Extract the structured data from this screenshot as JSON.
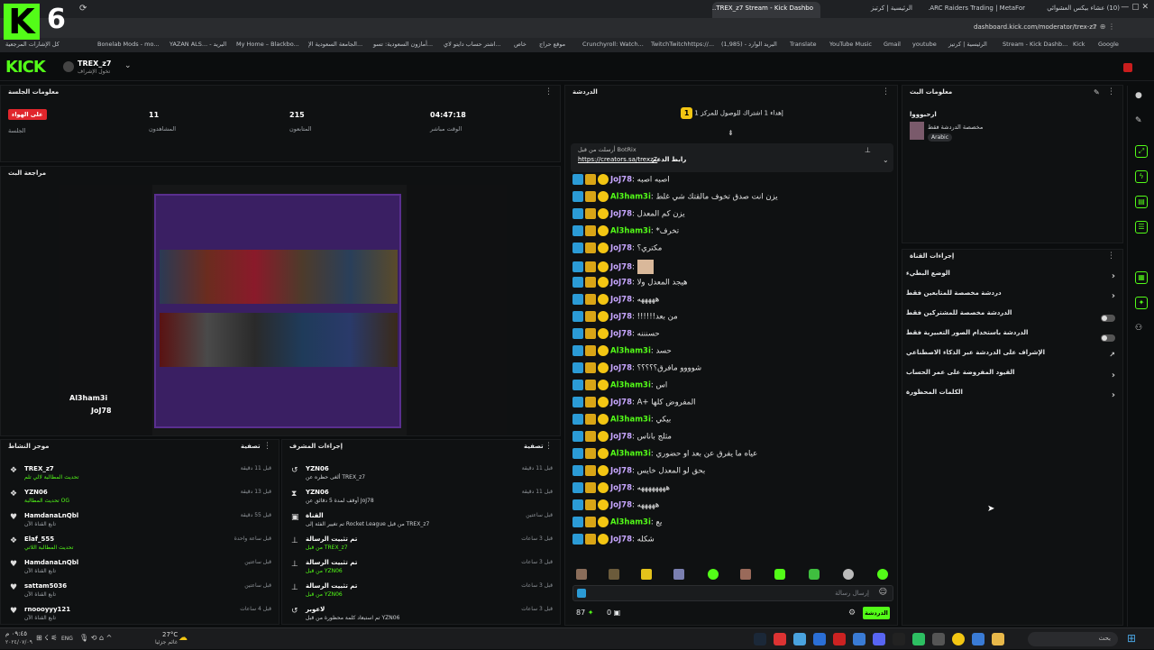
{
  "browser": {
    "tabs": [
      "(10) عشاء بيكس العشوائي",
      "ARC Raiders Trading | MetaFor...",
      "الرئيسية | كرتيز",
      "TREX_z7 Stream - Kick Dashbo..."
    ],
    "url": "dashboard.kick.com/moderator/trex-z7",
    "bookmarks": [
      "كل الإشارات المرجعية",
      "Bonelab Mods - mo...",
      "YAZAN ALS... - البريد",
      "My Home – Blackbo...",
      "الجامعة السعودية الإ...",
      "أمازون السعودية: تسو...",
      "اشتر حساب دايتو لاي...",
      "خاص",
      "موقع حراج",
      "Crunchyroll: Watch...",
      "TwitchTwitchhttps://...",
      "البريد الوارد - (1,985)",
      "Translate",
      "YouTube Music",
      "Gmail",
      "youtube",
      "الرئيسية | كرتيز",
      "Stream - Kick Dashb...",
      "Kick",
      "Google"
    ]
  },
  "header": {
    "logo": "KICK",
    "channel": "TREX_z7",
    "channel_sub": "تخول الإشراف"
  },
  "session": {
    "title": "معلومات الجلسة",
    "live_badge": "على الهواء",
    "stats": [
      {
        "label": "الجلسة",
        "value": ""
      },
      {
        "label": "المشاهدون",
        "value": "11"
      },
      {
        "label": "المتابعون",
        "value": "215"
      },
      {
        "label": "الوقت مباشر",
        "value": "04:47:18"
      }
    ]
  },
  "preview": {
    "title": "مراجعة البث",
    "overlay_name": "Al3ham3i",
    "overlay_name2": "JoJ78"
  },
  "activity": {
    "title": "موجز النشاط",
    "filter": "تصفية",
    "items": [
      {
        "name": "TREX_z7",
        "sub": "تحديث المطالبة لالي تلم",
        "time": "قبل 11 دقيقة",
        "icon": "gift-icon"
      },
      {
        "name": "YZN06",
        "sub": "تحديث المطالبة OG",
        "time": "قبل 13 دقيقة",
        "icon": "gift-icon"
      },
      {
        "name": "HamdanaLnQbl",
        "sub": "تابع القناة الآن",
        "time": "قبل 55 دقيقة",
        "icon": "heart-icon"
      },
      {
        "name": "Elaf_555",
        "sub": "تحديث المطالبة اللاتي",
        "time": "قبل ساعة واحدة",
        "icon": "gift-icon"
      },
      {
        "name": "HamdanaLnQbl",
        "sub": "تابع القناة الآن",
        "time": "قبل ساعتين",
        "icon": "heart-icon"
      },
      {
        "name": "sattam5036",
        "sub": "تابع القناة الآن",
        "time": "قبل ساعتين",
        "icon": "heart-icon"
      },
      {
        "name": "rnoooyyy121",
        "sub": "تابع القناة الآن",
        "time": "قبل 4 ساعات",
        "icon": "heart-icon"
      }
    ]
  },
  "mod_actions": {
    "title": "إجراءات المشرف",
    "filter": "تصفية",
    "items": [
      {
        "name": "YZN06",
        "sub": "ألغى حظره عن TREX_z7",
        "time": "قبل 11 دقيقة",
        "icon": "undo-icon"
      },
      {
        "name": "YZN06",
        "sub": "أوقف لمدة 5 دقائق عن JoJ78",
        "time": "قبل 11 دقيقة",
        "icon": "hourglass-icon"
      },
      {
        "name": "القناة",
        "sub": "تم تغيير الفئة إلى Rocket League من قبل TREX_z7",
        "time": "قبل ساعتين",
        "icon": "category-icon"
      },
      {
        "name": "تم تثبيت الرسالة",
        "sub": "من قبل TREX_z7",
        "time": "قبل 3 ساعات",
        "icon": "pin-icon"
      },
      {
        "name": "تم تثبيت الرسالة",
        "sub": "من قبل YZN06",
        "time": "قبل 3 ساعات",
        "icon": "pin-icon"
      },
      {
        "name": "تم تثبيت الرسالة",
        "sub": "من قبل YZN06",
        "time": "قبل 3 ساعات",
        "icon": "pin-icon"
      },
      {
        "name": "لاعوبر",
        "sub": "تم استبعاد كلمة محظورة من قبل YZN06",
        "time": "قبل 3 ساعات",
        "icon": "undo-icon"
      }
    ]
  },
  "chat": {
    "title": "الدردشة",
    "goal": "إهداء 1 اشتراك للوصول للمركز 1",
    "pinned_by": "أرسلت من قبل BotRix",
    "pinned_label": "رابط الدعم",
    "pinned_link": "https://creators.sa/trexz7",
    "messages": [
      {
        "user": "JoJ78",
        "text": "اصبه اصبه",
        "color": "#c7a6ff"
      },
      {
        "user": "Al3ham3i",
        "text": "يزن انت صدق تخوف مالقتك شي غلط",
        "color": "#53fc18"
      },
      {
        "user": "JoJ78",
        "text": "يزن كم المعدل",
        "color": "#c7a6ff"
      },
      {
        "user": "Al3ham3i",
        "text": "*تخرف",
        "color": "#53fc18"
      },
      {
        "user": "JoJ78",
        "text": "مكتري؟",
        "color": "#c7a6ff"
      },
      {
        "user": "JoJ78",
        "text": "",
        "color": "#c7a6ff"
      },
      {
        "user": "JoJ78",
        "text": "هيجد المعدل ولا",
        "color": "#c7a6ff"
      },
      {
        "user": "JoJ78",
        "text": "هههههه",
        "color": "#c7a6ff"
      },
      {
        "user": "JoJ78",
        "text": "!!!!!!من بعد",
        "color": "#c7a6ff"
      },
      {
        "user": "JoJ78",
        "text": "حسنننه",
        "color": "#c7a6ff"
      },
      {
        "user": "Al3ham3i",
        "text": "حسد",
        "color": "#53fc18"
      },
      {
        "user": "JoJ78",
        "text": "شوووو مافرق؟؟؟؟؟",
        "color": "#c7a6ff"
      },
      {
        "user": "Al3ham3i",
        "text": "اس",
        "color": "#53fc18"
      },
      {
        "user": "JoJ78",
        "text": "A+ المفروض كلها",
        "color": "#c7a6ff"
      },
      {
        "user": "Al3ham3i",
        "text": "بيكي",
        "color": "#53fc18"
      },
      {
        "user": "JoJ78",
        "text": "مثلج باناس",
        "color": "#c7a6ff"
      },
      {
        "user": "Al3ham3i",
        "text": "عياه ما يفرق عن بعد او حضوري",
        "color": "#53fc18"
      },
      {
        "user": "JoJ78",
        "text": "بحق لو المعدل خايس",
        "color": "#c7a6ff"
      },
      {
        "user": "JoJ78",
        "text": "ههههههههه",
        "color": "#c7a6ff"
      },
      {
        "user": "JoJ78",
        "text": "هههههه",
        "color": "#c7a6ff"
      },
      {
        "user": "Al3ham3i",
        "text": "يع",
        "color": "#53fc18"
      },
      {
        "user": "JoJ78",
        "text": "شكله",
        "color": "#c7a6ff"
      }
    ],
    "input_placeholder": "إرسال رسالة",
    "send_label": "الدردشة",
    "points": "87",
    "counter": "0"
  },
  "stream_info": {
    "title": "معلومات البث",
    "stream_title": "ارحبوووا",
    "subtitle": "مخصصة الدردشة فقط",
    "language": "Arabic"
  },
  "channel_actions": {
    "title": "إجراءات القناة",
    "rows": [
      {
        "label": "الوضع البطيء",
        "kind": "chevron"
      },
      {
        "label": "دردشة مخصصة للمتابعين فقط",
        "kind": "chevron"
      },
      {
        "label": "الدردشة مخصصة للمشتركين فقط",
        "kind": "toggle"
      },
      {
        "label": "الدردشة باستخدام الصور التعبيرية فقط",
        "kind": "toggle"
      },
      {
        "label": "الإشراف على الدردشة عبر الذكاء الاصطناعي",
        "kind": "link"
      },
      {
        "label": "القيود المفروضة على عمر الحساب",
        "kind": "chevron"
      },
      {
        "label": "الكلمات المحظورة",
        "kind": "chevron"
      }
    ]
  },
  "taskbar": {
    "weather": "27°C",
    "weather_sub": "غائم جزئيا",
    "lang": "ENG",
    "time": "٠٩:٤٥ م",
    "date": "٢٠٢٤/٠٧/٠٩",
    "search": "بحث"
  }
}
